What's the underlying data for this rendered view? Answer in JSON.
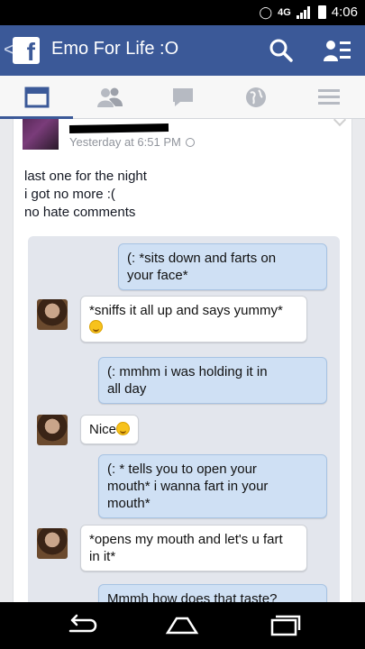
{
  "status_bar": {
    "network": "4G",
    "time": "4:06"
  },
  "app_bar": {
    "title": "Emo For Life :O",
    "back_glyph": "<",
    "logo": "f"
  },
  "tabs": [
    "news-feed-icon",
    "friends-icon",
    "messages-icon",
    "notifications-globe-icon",
    "more-menu-icon"
  ],
  "post": {
    "timestamp": "Yesterday at 6:51 PM",
    "text_lines": [
      "last one for the night",
      "i got no more :(",
      "no hate comments"
    ]
  },
  "conversation": [
    {
      "sender": "me",
      "lines": [
        "(:  *sits down and farts on",
        "your face*"
      ]
    },
    {
      "sender": "them",
      "lines": [
        "*sniffs it all up and says yummy*"
      ]
    },
    {
      "sender": "me",
      "lines": [
        "(:  mmhm  i  was  holding  it  in",
        "all  day"
      ]
    },
    {
      "sender": "them",
      "lines": [
        "Nice"
      ]
    },
    {
      "sender": "me",
      "lines": [
        "(:  * tells  you  to  open  your",
        "mouth*   i  wanna  fart  in  your",
        "mouth*"
      ]
    },
    {
      "sender": "them",
      "lines": [
        "*opens my mouth and let's u fart",
        "in it*"
      ]
    },
    {
      "sender": "me",
      "lines": [
        "Mmmh  how  does  that  taste?"
      ]
    }
  ],
  "colors": {
    "brand": "#3b5998",
    "my_bubble": "#cfe0f4",
    "their_bubble": "#ffffff"
  }
}
